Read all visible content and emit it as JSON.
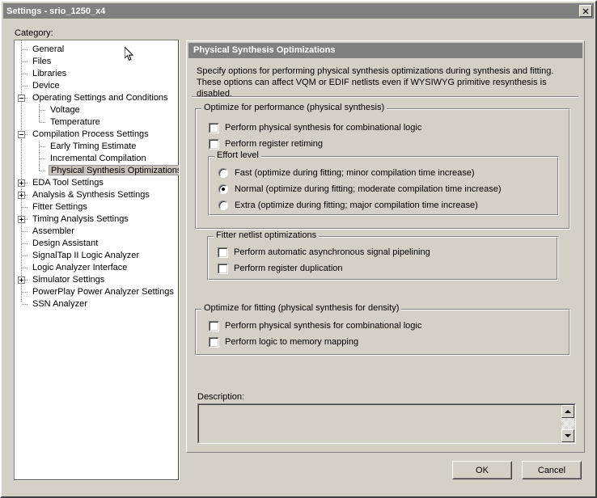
{
  "window": {
    "title": "Settings - srio_1250_x4",
    "close_icon": "close-icon",
    "close_label": "✕"
  },
  "left": {
    "category_label": "Category:",
    "tree": [
      {
        "label": "General",
        "depth": 1,
        "toggle": "none"
      },
      {
        "label": "Files",
        "depth": 1,
        "toggle": "none"
      },
      {
        "label": "Libraries",
        "depth": 1,
        "toggle": "none"
      },
      {
        "label": "Device",
        "depth": 1,
        "toggle": "none"
      },
      {
        "label": "Operating Settings and Conditions",
        "depth": 1,
        "toggle": "minus"
      },
      {
        "label": "Voltage",
        "depth": 2,
        "toggle": "none"
      },
      {
        "label": "Temperature",
        "depth": 2,
        "toggle": "none"
      },
      {
        "label": "Compilation Process Settings",
        "depth": 1,
        "toggle": "minus"
      },
      {
        "label": "Early Timing Estimate",
        "depth": 2,
        "toggle": "none"
      },
      {
        "label": "Incremental Compilation",
        "depth": 2,
        "toggle": "none"
      },
      {
        "label": "Physical Synthesis Optimizations",
        "depth": 2,
        "toggle": "none",
        "selected": true
      },
      {
        "label": "EDA Tool Settings",
        "depth": 1,
        "toggle": "plus"
      },
      {
        "label": "Analysis & Synthesis Settings",
        "depth": 1,
        "toggle": "plus"
      },
      {
        "label": "Fitter Settings",
        "depth": 1,
        "toggle": "none"
      },
      {
        "label": "Timing Analysis Settings",
        "depth": 1,
        "toggle": "plus"
      },
      {
        "label": "Assembler",
        "depth": 1,
        "toggle": "none"
      },
      {
        "label": "Design Assistant",
        "depth": 1,
        "toggle": "none"
      },
      {
        "label": "SignalTap II Logic Analyzer",
        "depth": 1,
        "toggle": "none"
      },
      {
        "label": "Logic Analyzer Interface",
        "depth": 1,
        "toggle": "none"
      },
      {
        "label": "Simulator Settings",
        "depth": 1,
        "toggle": "plus"
      },
      {
        "label": "PowerPlay Power Analyzer Settings",
        "depth": 1,
        "toggle": "none"
      },
      {
        "label": "SSN Analyzer",
        "depth": 1,
        "toggle": "none"
      }
    ]
  },
  "panel": {
    "header": "Physical Synthesis Optimizations",
    "description": "Specify options for performing physical synthesis optimizations during synthesis and fitting. These options can affect VQM or EDIF netlists even if WYSIWYG primitive resynthesis is disabled.",
    "group_performance": {
      "title": "Optimize for performance (physical synthesis)",
      "checkboxes": [
        {
          "label": "Perform physical synthesis for combinational logic",
          "checked": false
        },
        {
          "label": "Perform register retiming",
          "checked": false
        }
      ],
      "effort": {
        "title": "Effort level",
        "options": [
          {
            "label": "Fast (optimize during fitting; minor compilation time increase)",
            "selected": false
          },
          {
            "label": "Normal (optimize during fitting; moderate compilation time increase)",
            "selected": true
          },
          {
            "label": "Extra (optimize during fitting; major compilation time increase)",
            "selected": false
          }
        ]
      },
      "fitter_netlist": {
        "title": "Fitter netlist optimizations",
        "checkboxes": [
          {
            "label": "Perform automatic asynchronous signal pipelining",
            "checked": false
          },
          {
            "label": "Perform register duplication",
            "checked": false
          }
        ]
      }
    },
    "group_fitting": {
      "title": "Optimize for fitting (physical synthesis for density)",
      "checkboxes": [
        {
          "label": "Perform physical synthesis for combinational logic",
          "checked": false
        },
        {
          "label": "Perform logic to memory mapping",
          "checked": false
        }
      ]
    }
  },
  "description_area": {
    "label": "Description:",
    "value": "",
    "scroll_up_icon": "scroll-up-arrow-icon",
    "scroll_down_icon": "scroll-down-arrow-icon"
  },
  "buttons": {
    "ok": "OK",
    "cancel": "Cancel"
  },
  "colors": {
    "dialog_face": "#d4d0c8",
    "titlebar": "#808080",
    "titlebar_text": "#ffffff",
    "tree_background": "#ffffff",
    "selection": "#c8c4bc",
    "text": "#000000"
  }
}
